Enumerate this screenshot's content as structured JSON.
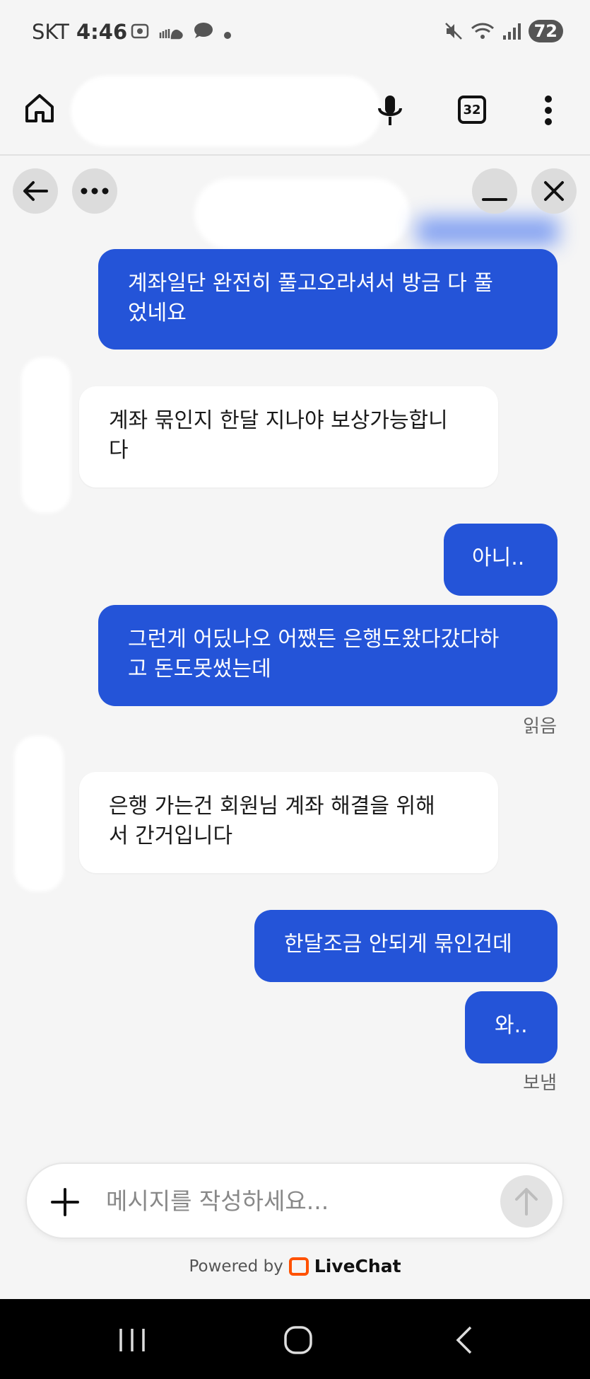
{
  "status_bar": {
    "carrier": "SKT",
    "time": "4:46",
    "battery": "72",
    "notif_icons": [
      "screenshot-icon",
      "soundcloud-icon",
      "chat-bubble-icon",
      "dot-icon"
    ],
    "right_icons": [
      "mute-icon",
      "wifi-icon",
      "signal-icon"
    ]
  },
  "browser": {
    "tab_count": "32"
  },
  "messages": [
    {
      "side": "out",
      "text": "계좌일단 완전히 풀고오라셔서 방금 다 풀\n었네요"
    },
    {
      "side": "in",
      "text": "계좌 묶인지 한달 지나야 보상가능합니\n다"
    },
    {
      "side": "out",
      "text": "아니.."
    },
    {
      "side": "out",
      "text": "그런게 어딨나오 어쨌든 은행도왔다갔다하\n고 돈도못썼는데"
    },
    {
      "side": "in",
      "text": "은행 가는건 회원님 계좌 해결을 위해\n서 간거입니다"
    },
    {
      "side": "out",
      "text": "한달조금 안되게 묶인건데"
    },
    {
      "side": "out",
      "text": "와.."
    }
  ],
  "read_label": "읽음",
  "sent_label": "보냄",
  "composer": {
    "placeholder": "메시지를 작성하세요..."
  },
  "footer": {
    "powered_by": "Powered by",
    "brand": "LiveChat"
  },
  "colors": {
    "outgoing_bubble": "#2454d8",
    "incoming_bubble": "#ffffff",
    "brand_orange": "#ff5100"
  }
}
